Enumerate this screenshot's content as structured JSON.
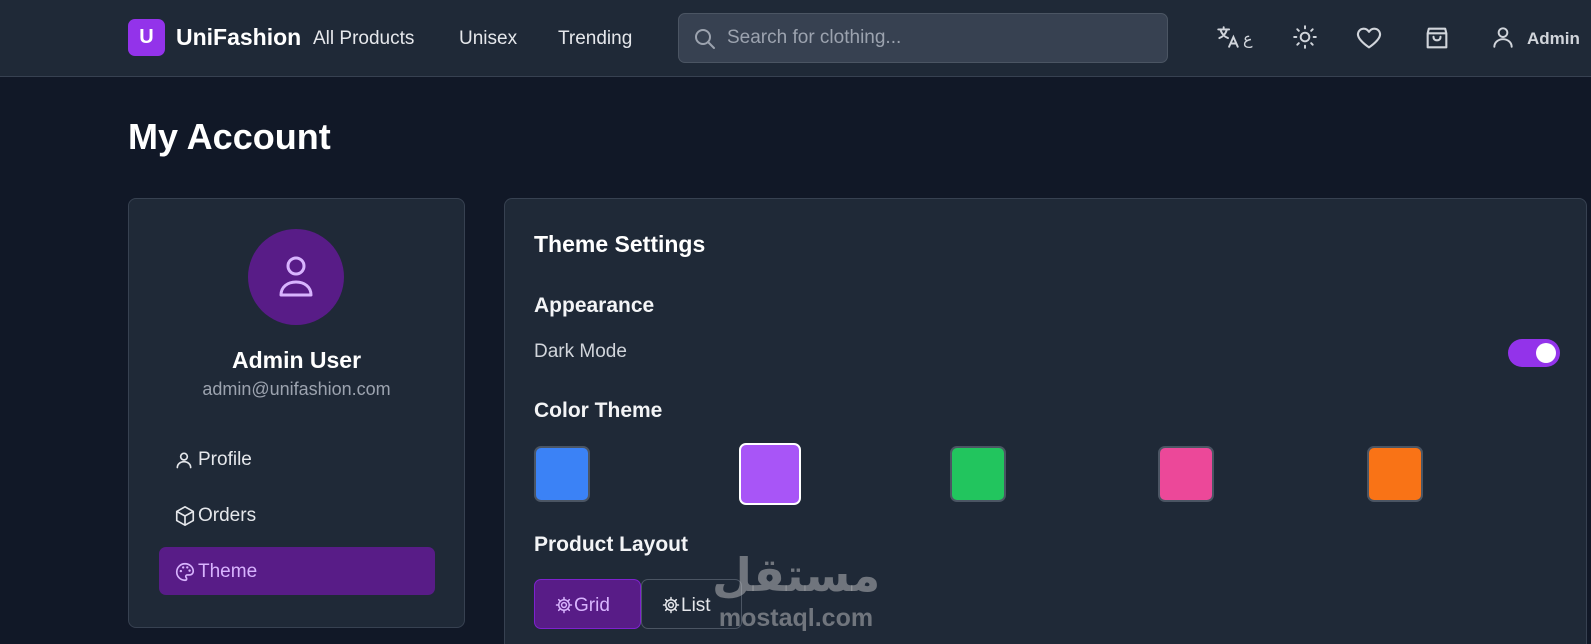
{
  "header": {
    "logo_letter": "U",
    "brand": "UniFashion",
    "nav": [
      "All Products",
      "Unisex",
      "Trending"
    ],
    "search_placeholder": "Search for clothing...",
    "language_label": "ع",
    "user_label": "Admin",
    "icons": [
      "translate-icon",
      "sun-icon",
      "heart-icon",
      "shopping-bag-icon",
      "user-icon"
    ]
  },
  "page": {
    "title": "My Account"
  },
  "sidebar": {
    "name": "Admin User",
    "email": "admin@unifashion.com",
    "items": [
      {
        "label": "Profile",
        "icon": "user-icon",
        "active": false
      },
      {
        "label": "Orders",
        "icon": "package-icon",
        "active": false
      },
      {
        "label": "Theme",
        "icon": "palette-icon",
        "active": true
      }
    ]
  },
  "theme": {
    "title": "Theme Settings",
    "appearance_heading": "Appearance",
    "dark_mode_label": "Dark Mode",
    "dark_mode_on": true,
    "color_heading": "Color Theme",
    "colors": [
      "#3b82f6",
      "#a855f7",
      "#22c55e",
      "#ec4899",
      "#f97316"
    ],
    "selected_color": "#a855f7",
    "layout_heading": "Product Layout",
    "layout_options": [
      "Grid",
      "List"
    ],
    "selected_layout": "Grid"
  },
  "watermark": {
    "arabic": "مستقل",
    "latin": "mostaql.com"
  },
  "colors": {
    "accent": "#9333ea",
    "accent_dark": "#581c87",
    "accent_text": "#d8b4fe",
    "background": "#111827",
    "surface": "#1f2937"
  }
}
